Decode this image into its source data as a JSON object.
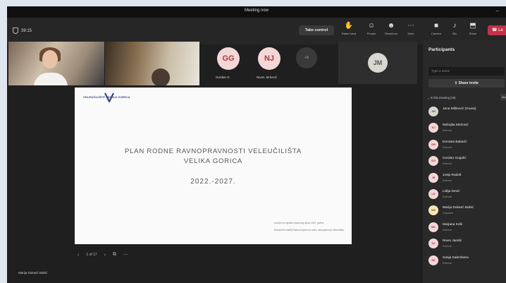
{
  "window": {
    "title": "Meeting now"
  },
  "toolbar": {
    "timer": "39:15",
    "take_control": "Take control",
    "buttons": [
      {
        "icon": "hand-raise-icon",
        "label": "Raise hand"
      },
      {
        "icon": "people-icon",
        "label": "People"
      },
      {
        "icon": "reactions-icon",
        "label": "Reactions"
      },
      {
        "icon": "more-icon",
        "label": "More"
      },
      {
        "icon": "camera-icon",
        "label": "Camera"
      },
      {
        "icon": "mic-icon",
        "label": "Mic"
      },
      {
        "icon": "share-icon",
        "label": "Share"
      }
    ],
    "leave_label": "Le"
  },
  "tiles": [
    {
      "initials": "GG",
      "name": "Gordan G."
    },
    {
      "initials": "NJ",
      "name": "Nives Jerković"
    },
    {
      "initials": "+8"
    },
    {
      "initials": "JM"
    }
  ],
  "slide": {
    "logo_text": "VELEUČILIŠTE VELIKA GORICA",
    "title_line1": "PLAN RODNE RAVNOPRAVNOSTI VELEUČILIŠTA",
    "title_line2": "VELIKA GORICA",
    "years": "2022.-2027.",
    "note1": "Usvojen na sjednici Upravnog vijeća 2022. godine",
    "note2": "Dokument izradila Radna skupina za rodnu ravnopravnost Veleučilišta",
    "counter": "1 of 17"
  },
  "presenter": "Marija Dukarić Babić",
  "panel": {
    "title": "Participants",
    "search_placeholder": "Type a name",
    "share_invite": "Share invite",
    "section_label": "In this meeting (19)",
    "mute_all": "Mu",
    "participants": [
      {
        "initials": "JM",
        "name": "Jana Mišković (Guest)",
        "role": "",
        "bg": "#d9d5cf",
        "fg": "#555555"
      },
      {
        "initials": "NJ",
        "name": "Nebojša Mehović",
        "role": "External",
        "bg": "#f3d7d7",
        "fg": "#a83a47"
      },
      {
        "initials": "DB",
        "name": "Dorotea Babarić",
        "role": "External",
        "bg": "#f3d7d7",
        "fg": "#a83a47"
      },
      {
        "initials": "GG",
        "name": "Gordan Gogolić",
        "role": "External",
        "bg": "#f3d7d7",
        "fg": "#a83a47"
      },
      {
        "initials": "JR",
        "name": "Josip Radoš",
        "role": "External",
        "bg": "#f3d7d7",
        "fg": "#a83a47"
      },
      {
        "initials": "LD",
        "name": "Lidija Dević",
        "role": "External",
        "bg": "#f3d7d7",
        "fg": "#a83a47"
      },
      {
        "initials": "MB",
        "name": "Marija Dukarić Babić",
        "role": "Organizer",
        "bg": "#f3e6b8",
        "fg": "#8a6d1e"
      },
      {
        "initials": "MK",
        "name": "Marjana Kolli",
        "role": "External",
        "bg": "#f3d7d7",
        "fg": "#a83a47"
      },
      {
        "initials": "NJ",
        "name": "Nives Jandić",
        "role": "External",
        "bg": "#f3d7d7",
        "fg": "#a83a47"
      },
      {
        "initials": "SK",
        "name": "Sanja Kalembera",
        "role": "External",
        "bg": "#f3d7d7",
        "fg": "#a83a47"
      }
    ]
  }
}
